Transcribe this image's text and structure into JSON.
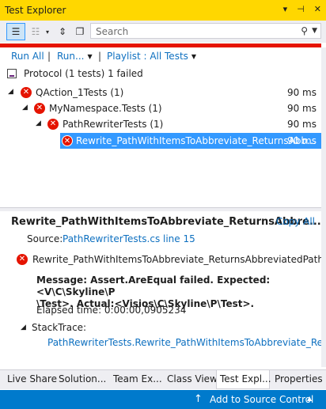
{
  "window": {
    "title": "Test Explorer"
  },
  "search": {
    "placeholder": "Search"
  },
  "commands": {
    "run_all": "Run All",
    "run": "Run...",
    "playlist": "Playlist : All Tests"
  },
  "tree": {
    "protocol": "Protocol (1 tests) 1 failed",
    "rows": [
      {
        "label": "QAction_1Tests (1)",
        "time": "90 ms"
      },
      {
        "label": "MyNamespace.Tests (1)",
        "time": "90 ms"
      },
      {
        "label": "PathRewriterTests (1)",
        "time": "90 ms"
      },
      {
        "label": "Rewrite_PathWithItemsToAbbreviate_ReturnsAbb...",
        "time": "90 ms"
      }
    ]
  },
  "details": {
    "title": "Rewrite_PathWithItemsToAbbreviate_ReturnsAbbre...",
    "copy_all": "Copy All",
    "source_label": "Source:",
    "source_link": "PathRewriterTests.cs line 15",
    "test_name": "Rewrite_PathWithItemsToAbbreviate_ReturnsAbbreviatedPath",
    "message_line1": "Message: Assert.AreEqual failed. Expected:<V\\C\\Skyline\\P",
    "message_line2": "\\Test>. Actual:<Visios\\C\\Skyline\\P\\Test>.",
    "elapsed": "Elapsed time: 0:00:00,0905234",
    "stacktrace_label": "StackTrace:",
    "stacktrace_link": "PathRewriterTests.Rewrite_PathWithItemsToAbbreviate_ReturnsAb"
  },
  "tabs": [
    "Live Share",
    "Solution...",
    "Team Ex...",
    "Class View",
    "Test Expl...",
    "Properties"
  ],
  "status": {
    "text": "Add to Source Control"
  }
}
